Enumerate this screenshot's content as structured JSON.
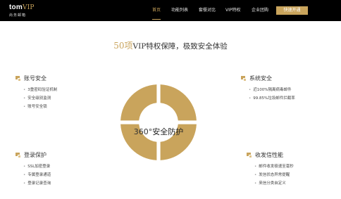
{
  "logo": {
    "brand": "tom",
    "vip": "VIP",
    "sub": "尚务邮箱"
  },
  "nav": {
    "items": [
      "首页",
      "功能列表",
      "套餐对比",
      "VIP特权",
      "企业团购"
    ],
    "active_index": 0,
    "cta": "快速开通"
  },
  "headline": {
    "num": "50项",
    "text": "VIP特权保障，极致安全体验"
  },
  "center": {
    "deg": "360°",
    "text": "安全防护"
  },
  "features": [
    {
      "title": "账号安全",
      "items": [
        "3重密码验证机制",
        "安全级别监测",
        "账号安全锁"
      ]
    },
    {
      "title": "系统安全",
      "items": [
        "近100%隔离病毒邮件",
        "99.85%垃圾邮件拦截率"
      ]
    },
    {
      "title": "登录保护",
      "items": [
        "SSL加密登录",
        "专属登录通道",
        "登录记录查询"
      ]
    },
    {
      "title": "收发信性能",
      "items": [
        "邮件收发极速至毫秒",
        "发信状态异常提醒",
        "来信分类自定义"
      ]
    }
  ],
  "colors": {
    "gold": "#c9a45c",
    "bar": "#000000"
  }
}
